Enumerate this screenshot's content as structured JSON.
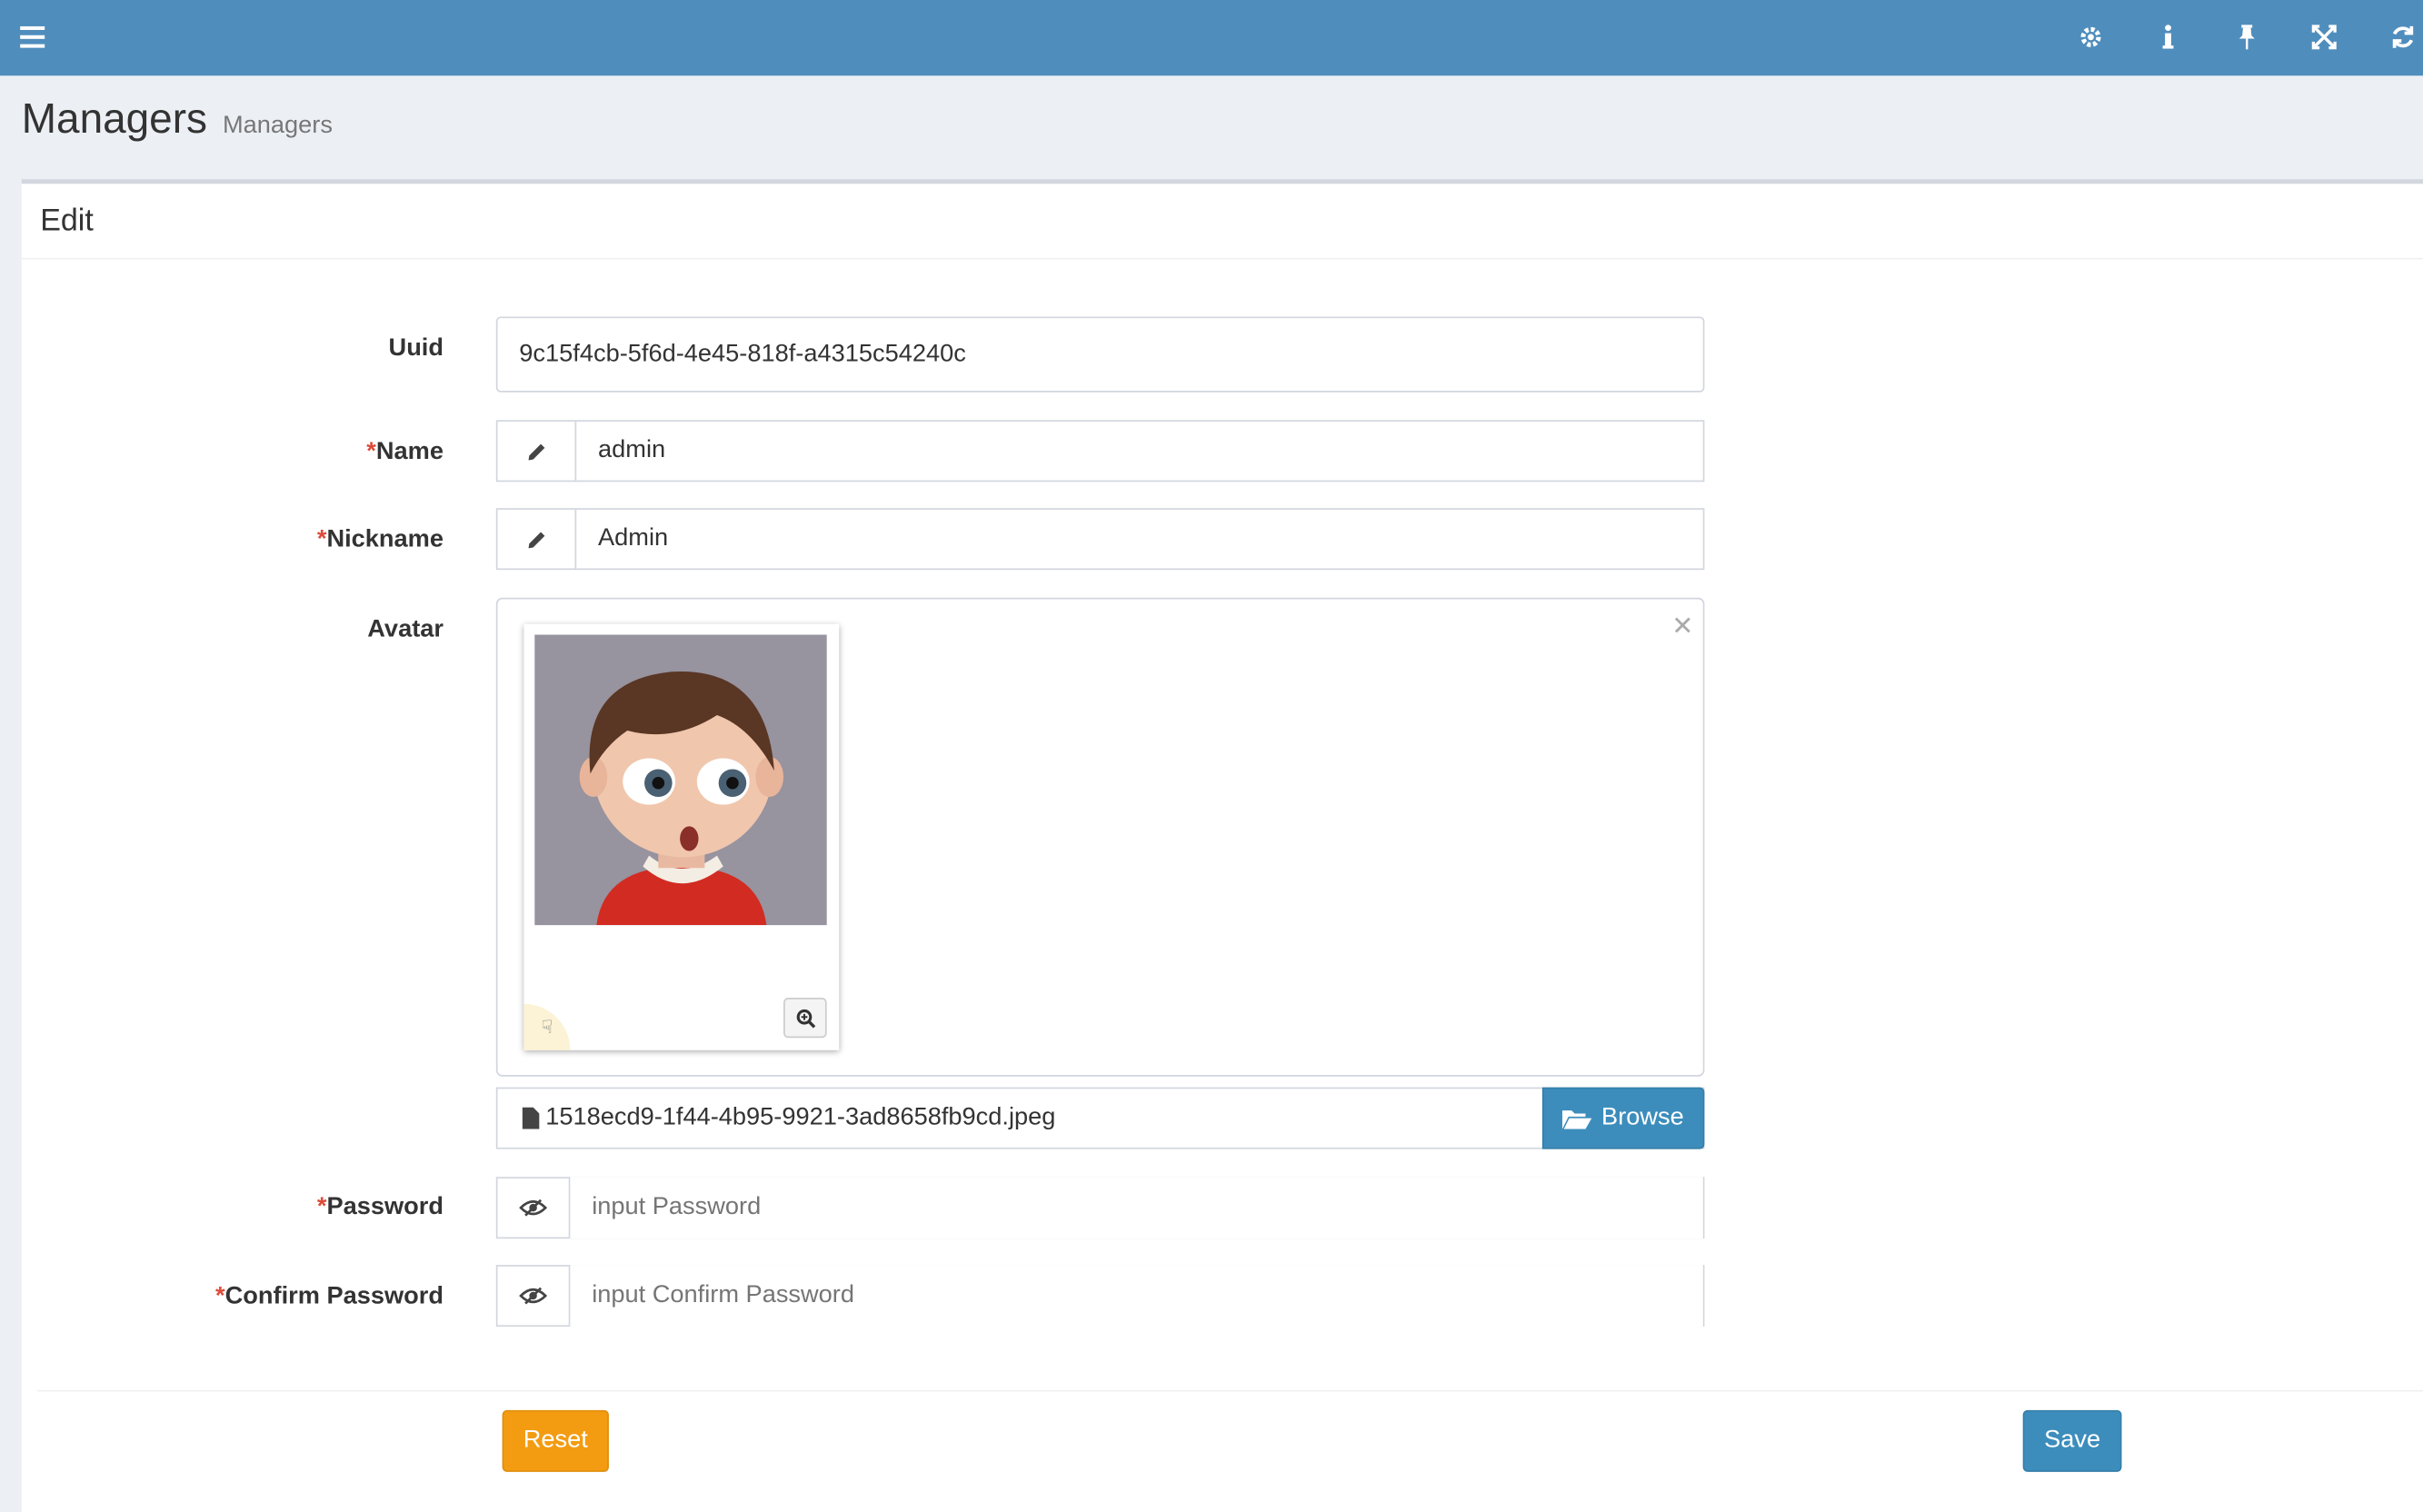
{
  "topbar": {
    "icons": [
      "menu-icon",
      "gear-icon",
      "info-icon",
      "pin-icon",
      "fullscreen-icon",
      "refresh-icon"
    ],
    "color": "#4f8dbd"
  },
  "header": {
    "title": "Managers",
    "subtitle": "Managers"
  },
  "box": {
    "title": "Edit"
  },
  "form": {
    "uuid": {
      "label": "Uuid",
      "value": "9c15f4cb-5f6d-4e45-818f-a4315c54240c"
    },
    "name": {
      "required": "*",
      "label": "Name",
      "value": "admin"
    },
    "nickname": {
      "required": "*",
      "label": "Nickname",
      "value": "Admin"
    },
    "avatar": {
      "label": "Avatar",
      "file": "1518ecd9-1f44-4b95-9921-3ad8658fb9cd.jpeg",
      "browse": "Browse"
    },
    "password": {
      "required": "*",
      "label": "Password",
      "placeholder": "input Password"
    },
    "confirm_password": {
      "required": "*",
      "label": "Confirm Password",
      "placeholder": "input Confirm Password"
    }
  },
  "buttons": {
    "reset": "Reset",
    "save": "Save"
  },
  "colors": {
    "primary": "#3c8dbc",
    "warning": "#f39c12",
    "required": "#dd4b39"
  }
}
